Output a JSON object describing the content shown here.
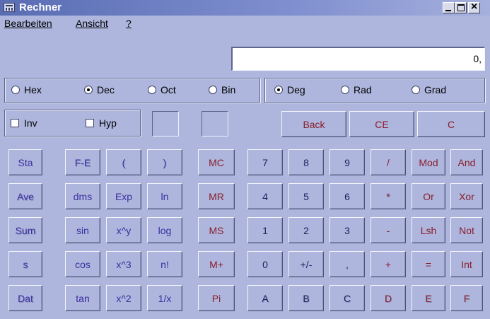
{
  "window": {
    "title": "Rechner"
  },
  "menu": [
    "Bearbeiten",
    "Ansicht",
    "?"
  ],
  "display": {
    "value": "0,"
  },
  "base_modes": {
    "options": [
      "Hex",
      "Dec",
      "Oct",
      "Bin"
    ],
    "selected": "Dec"
  },
  "angle_modes": {
    "options": [
      "Deg",
      "Rad",
      "Grad"
    ],
    "selected": "Deg"
  },
  "checkboxes": {
    "inv": "Inv",
    "hyp": "Hyp"
  },
  "edit_buttons": [
    "Back",
    "CE",
    "C"
  ],
  "colors": {
    "background": "#aeb6de",
    "title_bar": "#5a6db3",
    "display_bg": "#ffffff"
  },
  "keypad": [
    [
      {
        "label": "Sta",
        "enabled": true
      },
      {
        "label": "F-E",
        "enabled": false
      },
      {
        "label": "(",
        "enabled": false
      },
      {
        "label": ")",
        "enabled": false
      },
      {
        "label": "MC",
        "enabled": true
      },
      {
        "label": "7",
        "enabled": true
      },
      {
        "label": "8",
        "enabled": true
      },
      {
        "label": "9",
        "enabled": true
      },
      {
        "label": "/",
        "enabled": true
      },
      {
        "label": "Mod",
        "enabled": true
      },
      {
        "label": "And",
        "enabled": true
      }
    ],
    [
      {
        "label": "Ave",
        "enabled": false
      },
      {
        "label": "dms",
        "enabled": true
      },
      {
        "label": "Exp",
        "enabled": true
      },
      {
        "label": "ln",
        "enabled": true
      },
      {
        "label": "MR",
        "enabled": true
      },
      {
        "label": "4",
        "enabled": true
      },
      {
        "label": "5",
        "enabled": true
      },
      {
        "label": "6",
        "enabled": true
      },
      {
        "label": "*",
        "enabled": false
      },
      {
        "label": "Or",
        "enabled": true
      },
      {
        "label": "Xor",
        "enabled": true
      }
    ],
    [
      {
        "label": "Sum",
        "enabled": false
      },
      {
        "label": "sin",
        "enabled": true
      },
      {
        "label": "x^y",
        "enabled": true
      },
      {
        "label": "log",
        "enabled": true
      },
      {
        "label": "MS",
        "enabled": true
      },
      {
        "label": "1",
        "enabled": true
      },
      {
        "label": "2",
        "enabled": true
      },
      {
        "label": "3",
        "enabled": true
      },
      {
        "label": "-",
        "enabled": true
      },
      {
        "label": "Lsh",
        "enabled": true
      },
      {
        "label": "Not",
        "enabled": true
      }
    ],
    [
      {
        "label": "s",
        "enabled": false
      },
      {
        "label": "cos",
        "enabled": true
      },
      {
        "label": "x^3",
        "enabled": true
      },
      {
        "label": "n!",
        "enabled": true
      },
      {
        "label": "M+",
        "enabled": true
      },
      {
        "label": "0",
        "enabled": true
      },
      {
        "label": "+/-",
        "enabled": true
      },
      {
        "label": ",",
        "enabled": true
      },
      {
        "label": "+",
        "enabled": true
      },
      {
        "label": "=",
        "enabled": true
      },
      {
        "label": "Int",
        "enabled": true
      }
    ],
    [
      {
        "label": "Dat",
        "enabled": false
      },
      {
        "label": "tan",
        "enabled": true
      },
      {
        "label": "x^2",
        "enabled": true
      },
      {
        "label": "1/x",
        "enabled": true
      },
      {
        "label": "Pi",
        "enabled": true
      },
      {
        "label": "A",
        "enabled": false
      },
      {
        "label": "B",
        "enabled": false
      },
      {
        "label": "C",
        "enabled": false
      },
      {
        "label": "D",
        "enabled": false
      },
      {
        "label": "E",
        "enabled": false
      },
      {
        "label": "F",
        "enabled": false
      }
    ]
  ]
}
